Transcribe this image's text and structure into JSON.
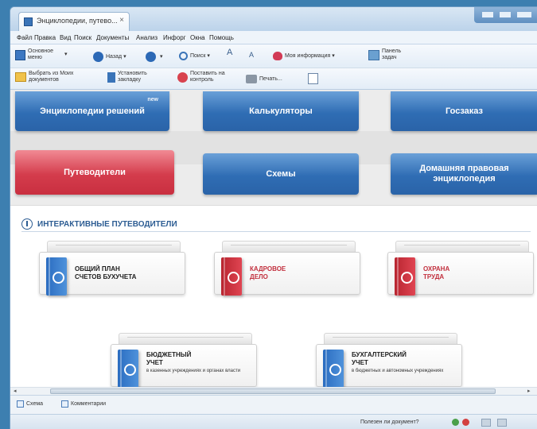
{
  "window": {
    "tab_title": "Энциклопедии, путево...",
    "tab_close": "×"
  },
  "menu": [
    "Файл",
    "Правка",
    "Вид",
    "Поиск",
    "Документы",
    "Анализ",
    "Инфорг",
    "Окна",
    "Помощь"
  ],
  "toolbar1": {
    "main_menu": "Основное меню",
    "back": "Назад",
    "search": "Поиск",
    "font_increase": "A",
    "font_decrease": "A",
    "my_info": "Моя информация",
    "task_panel": "Панель задач"
  },
  "toolbar2": {
    "select_docs": "Выбрать из Моих документов",
    "set_bookmark": "Установить закладку",
    "put_control": "Поставить на контроль",
    "print": "Печать..."
  },
  "nav": {
    "encyclopedias": "Энциклопедии решений",
    "encyclopedias_badge": "new",
    "calculators": "Калькуляторы",
    "goszakaz": "Госзаказ",
    "guides": "Путеводители",
    "schemes": "Схемы",
    "home_legal": "Домашняя правовая энциклопедия"
  },
  "section": {
    "title": "ИНТЕРАКТИВНЫЕ ПУТЕВОДИТЕЛИ"
  },
  "guides": [
    {
      "line1": "ОБЩИЙ ПЛАН",
      "line2": "СЧЕТОВ БУХУЧЕТА",
      "sub": ""
    },
    {
      "line1": "КАДРОВОЕ",
      "line2": "ДЕЛО",
      "sub": ""
    },
    {
      "line1": "ОХРАНА",
      "line2": "ТРУДА",
      "sub": ""
    },
    {
      "line1": "БЮДЖЕТНЫЙ",
      "line2": "УЧЕТ",
      "sub": "в казенных учреждениях и органах власти"
    },
    {
      "line1": "БУХГАЛТЕРСКИЙ",
      "line2": "УЧЕТ",
      "sub": "в бюджетных и автономных учреждениях"
    }
  ],
  "bottom_tabs": {
    "links": "Схема",
    "comments": "Комментарии"
  },
  "status": {
    "useful": "Полезен ли документ?"
  },
  "colors": {
    "accent_blue": "#2f6db4",
    "accent_red": "#d43c4c",
    "section_title": "#2d5d93"
  }
}
